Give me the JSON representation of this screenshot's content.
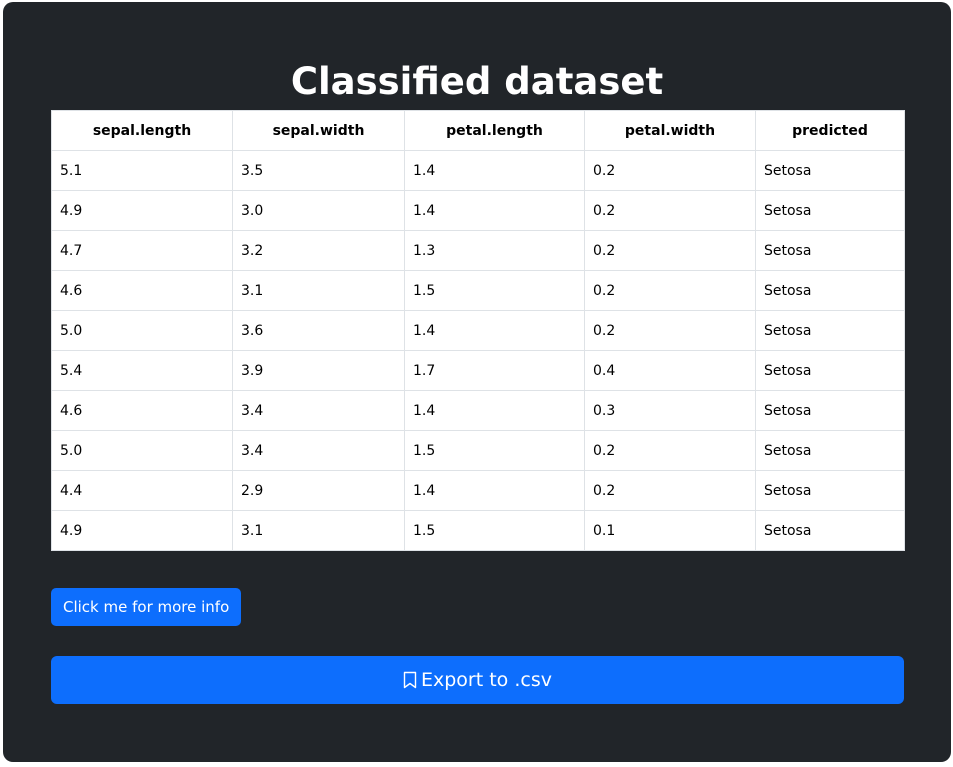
{
  "page": {
    "title": "Classified dataset"
  },
  "table": {
    "columns": [
      "sepal.length",
      "sepal.width",
      "petal.length",
      "petal.width",
      "predicted"
    ],
    "rows": [
      [
        "5.1",
        "3.5",
        "1.4",
        "0.2",
        "Setosa"
      ],
      [
        "4.9",
        "3.0",
        "1.4",
        "0.2",
        "Setosa"
      ],
      [
        "4.7",
        "3.2",
        "1.3",
        "0.2",
        "Setosa"
      ],
      [
        "4.6",
        "3.1",
        "1.5",
        "0.2",
        "Setosa"
      ],
      [
        "5.0",
        "3.6",
        "1.4",
        "0.2",
        "Setosa"
      ],
      [
        "5.4",
        "3.9",
        "1.7",
        "0.4",
        "Setosa"
      ],
      [
        "4.6",
        "3.4",
        "1.4",
        "0.3",
        "Setosa"
      ],
      [
        "5.0",
        "3.4",
        "1.5",
        "0.2",
        "Setosa"
      ],
      [
        "4.4",
        "2.9",
        "1.4",
        "0.2",
        "Setosa"
      ],
      [
        "4.9",
        "3.1",
        "1.5",
        "0.1",
        "Setosa"
      ]
    ]
  },
  "buttons": {
    "info_label": "Click me for more info",
    "export_label": "Export to .csv",
    "export_icon": "bookmark-icon"
  },
  "colors": {
    "background": "#212529",
    "primary": "#0d6efd"
  }
}
